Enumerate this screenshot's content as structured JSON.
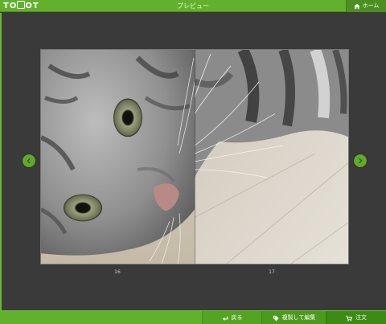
{
  "header": {
    "logo_text": "TOLOT",
    "title": "プレビュー",
    "home_label": "ホーム"
  },
  "viewer": {
    "left_page_number": "16",
    "right_page_number": "17"
  },
  "footer": {
    "back_label": "戻る",
    "copy_edit_label": "複製して編集",
    "order_label": "注文"
  },
  "colors": {
    "accent": "#62b12c",
    "background": "#3a3a3a"
  },
  "icons": {
    "home": "home-icon",
    "prev": "arrow-left-icon",
    "next": "arrow-right-icon",
    "back": "return-icon",
    "copy": "tag-icon",
    "order": "cart-icon"
  }
}
